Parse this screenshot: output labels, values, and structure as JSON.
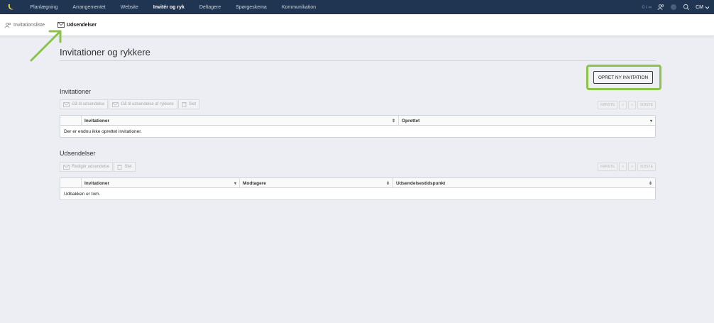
{
  "nav": {
    "items": [
      "Planlægning",
      "Arrangementet",
      "Website",
      "Invitér og ryk",
      "Deltagere",
      "Spørgeskema",
      "Kommunikation"
    ],
    "active_index": 3,
    "quota": "0 / ∞",
    "user": "CM"
  },
  "subnav": {
    "tabs": [
      "Invitationsliste",
      "Udsendelser"
    ]
  },
  "page": {
    "title": "Invitationer og rykkere",
    "create_button": "OPRET NY INVITATION"
  },
  "invitations": {
    "title": "Invitationer",
    "toolbar": [
      "Gå til udsendelse",
      "Gå til udsendelse af rykkere",
      "Slet"
    ],
    "pager": [
      "FØRSTE",
      "«",
      "»",
      "SIDSTE"
    ],
    "columns": [
      "Invitationer",
      "Oprettet"
    ],
    "empty": "Der er endnu ikke oprettet invitationer."
  },
  "dispatches": {
    "title": "Udsendelser",
    "toolbar": [
      "Redigér udsendelse",
      "Slet"
    ],
    "pager": [
      "FØRSTE",
      "«",
      "»",
      "SIDSTE"
    ],
    "columns": [
      "Invitationer",
      "Modtagere",
      "Udsendelsestidspunkt"
    ],
    "empty": "Udbakken er tom."
  },
  "colors": {
    "nav_bg": "#1f3551",
    "highlight": "#8bc34a",
    "page_bg": "#eceef3"
  }
}
